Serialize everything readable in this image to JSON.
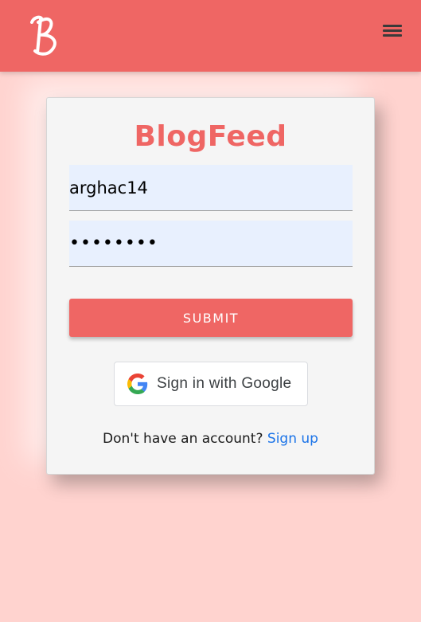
{
  "header": {
    "logo_letter": "B",
    "menu_icon": "hamburger-icon"
  },
  "login": {
    "title": "BlogFeed",
    "username_value": "arghac14",
    "password_value": "••••••••",
    "submit_label": "SUBMIT",
    "google_label": "Sign in with Google",
    "google_icon": "google-logo-icon",
    "no_account_text": "Don't have an account?",
    "signup_label": "Sign up"
  },
  "colors": {
    "brand": "#ef6664",
    "background": "#ffd3cf",
    "card": "#f5f5f5",
    "input_fill": "#e8f0fe",
    "link": "#1a73e8"
  }
}
